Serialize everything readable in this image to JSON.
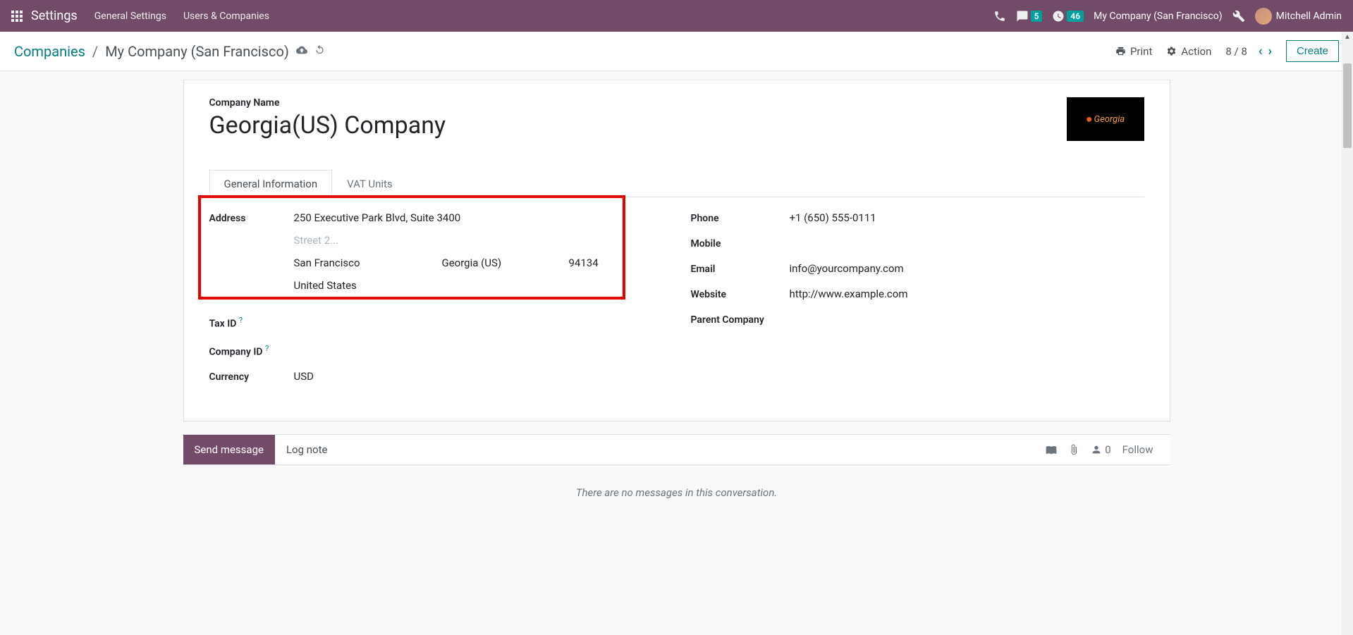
{
  "topbar": {
    "brand": "Settings",
    "menu": [
      "General Settings",
      "Users & Companies"
    ],
    "chat_badge": "5",
    "activity_badge": "46",
    "company": "My Company (San Francisco)",
    "user": "Mitchell Admin"
  },
  "controlbar": {
    "breadcrumb_root": "Companies",
    "breadcrumb_current": "My Company (San Francisco)",
    "print": "Print",
    "action": "Action",
    "pager": "8 / 8",
    "create": "Create"
  },
  "form": {
    "title_label": "Company Name",
    "title_value": "Georgia(US) Company",
    "logo_text": "Georgia",
    "tabs": [
      "General Information",
      "VAT Units"
    ],
    "left": {
      "address_label": "Address",
      "street": "250 Executive Park Blvd, Suite 3400",
      "street2_placeholder": "Street 2...",
      "city": "San Francisco",
      "state": "Georgia (US)",
      "zip": "94134",
      "country": "United States",
      "taxid_label": "Tax ID",
      "companyid_label": "Company ID",
      "currency_label": "Currency",
      "currency_value": "USD"
    },
    "right": {
      "phone_label": "Phone",
      "phone_value": "+1 (650) 555-0111",
      "mobile_label": "Mobile",
      "email_label": "Email",
      "email_value": "info@yourcompany.com",
      "website_label": "Website",
      "website_value": "http://www.example.com",
      "parent_label": "Parent Company"
    }
  },
  "chatter": {
    "send": "Send message",
    "lognote": "Log note",
    "followers": "0",
    "follow": "Follow",
    "empty": "There are no messages in this conversation."
  }
}
